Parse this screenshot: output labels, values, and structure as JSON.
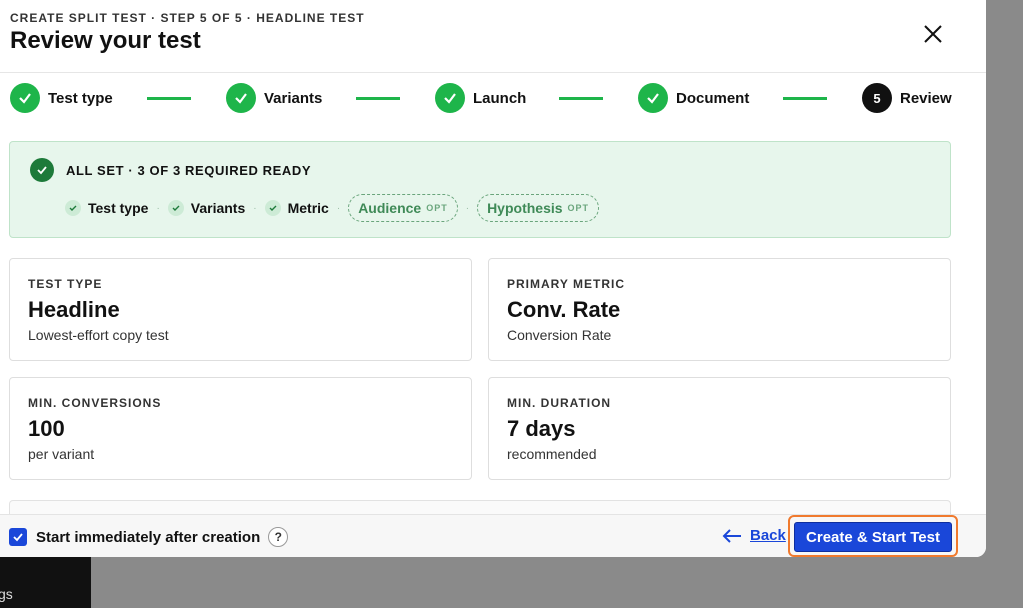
{
  "header": {
    "eyebrow": "CREATE SPLIT TEST · STEP 5 OF 5 · HEADLINE TEST",
    "title": "Review your test"
  },
  "stepper": {
    "steps": [
      {
        "label": "Test type",
        "state": "complete"
      },
      {
        "label": "Variants",
        "state": "complete"
      },
      {
        "label": "Launch",
        "state": "complete"
      },
      {
        "label": "Document",
        "state": "complete"
      },
      {
        "label": "Review",
        "state": "current",
        "number": "5"
      }
    ],
    "accent": "#1eb54a"
  },
  "ready": {
    "title": "ALL SET · 3 OF 3 REQUIRED READY",
    "checks": [
      "Test type",
      "Variants",
      "Metric"
    ],
    "optional": [
      {
        "label": "Audience",
        "tag": "OPT"
      },
      {
        "label": "Hypothesis",
        "tag": "OPT"
      }
    ]
  },
  "cards": {
    "test_type": {
      "label": "TEST TYPE",
      "value": "Headline",
      "sub": "Lowest-effort copy test"
    },
    "primary_metric": {
      "label": "PRIMARY METRIC",
      "value": "Conv. Rate",
      "sub": "Conversion Rate"
    },
    "min_conversions": {
      "label": "MIN. CONVERSIONS",
      "value": "100",
      "sub": "per variant"
    },
    "min_duration": {
      "label": "MIN. DURATION",
      "value": "7 days",
      "sub": "recommended"
    }
  },
  "footer": {
    "auto_start_label": "Start immediately after creation",
    "auto_start_checked": true,
    "help": "?",
    "back_arrow": "←",
    "back_label": "Back",
    "primary_label": "Create & Start Test",
    "primary_color": "#1a47d9"
  },
  "background": {
    "partial_text": "gs"
  }
}
